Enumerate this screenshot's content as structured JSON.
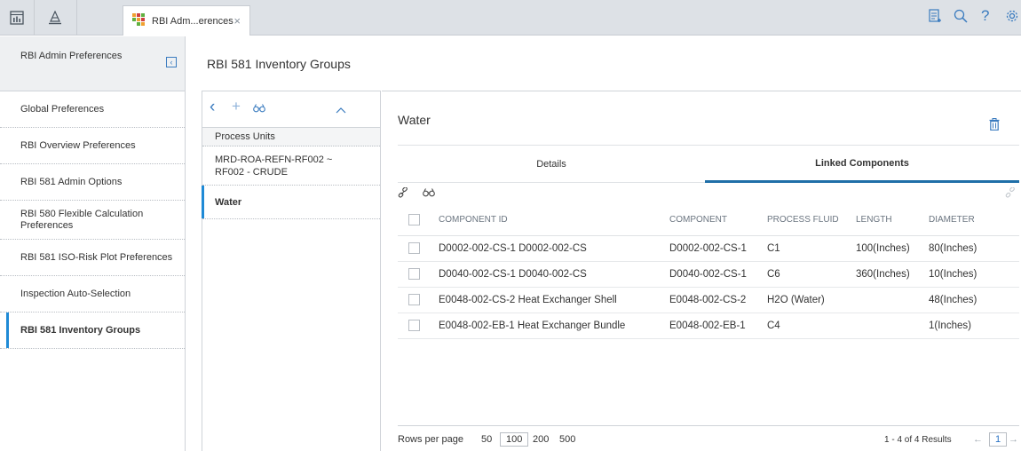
{
  "topbar": {
    "tab_label": "RBI Adm...erences",
    "tab_close": "×",
    "help_label": "?"
  },
  "sidebar": {
    "title": "RBI Admin Preferences",
    "collapse": "‹",
    "items": [
      {
        "label": "Global Preferences"
      },
      {
        "label": "RBI Overview Preferences"
      },
      {
        "label": "RBI 581 Admin Options"
      },
      {
        "label": "RBI 580 Flexible Calculation Preferences"
      },
      {
        "label": "RBI 581 ISO-Risk Plot Preferences"
      },
      {
        "label": "Inspection Auto-Selection"
      },
      {
        "label": "RBI 581 Inventory Groups"
      }
    ]
  },
  "main": {
    "page_title": "RBI 581 Inventory Groups"
  },
  "list": {
    "back": "‹",
    "add": "+",
    "collapse": "⌃",
    "header": "Process Units",
    "items": [
      {
        "label": "MRD-ROA-REFN-RF002 ~ RF002 - CRUDE"
      },
      {
        "label": "Water"
      }
    ]
  },
  "detail": {
    "title": "Water",
    "tabs": [
      {
        "label": "Details"
      },
      {
        "label": "Linked Components"
      }
    ],
    "columns": [
      "COMPONENT ID",
      "COMPONENT",
      "PROCESS FLUID",
      "LENGTH",
      "DIAMETER"
    ],
    "rows": [
      {
        "component_id": "D0002-002-CS-1 D0002-002-CS",
        "component": "D0002-002-CS-1",
        "fluid": "C1",
        "length": "100(Inches)",
        "diameter": "80(Inches)"
      },
      {
        "component_id": "D0040-002-CS-1 D0040-002-CS",
        "component": "D0040-002-CS-1",
        "fluid": "C6",
        "length": "360(Inches)",
        "diameter": "10(Inches)"
      },
      {
        "component_id": "E0048-002-CS-2 Heat Exchanger Shell",
        "component": "E0048-002-CS-2",
        "fluid": "H2O (Water)",
        "length": "",
        "diameter": "48(Inches)"
      },
      {
        "component_id": "E0048-002-EB-1 Heat Exchanger Bundle",
        "component": "E0048-002-EB-1",
        "fluid": "C4",
        "length": "",
        "diameter": "1(Inches)"
      }
    ],
    "footer": {
      "rows_per_page_label": "Rows per page",
      "options": [
        "50",
        "100",
        "200",
        "500"
      ],
      "selected_option": "100",
      "results": "1 - 4 of 4 Results",
      "page": "1",
      "prev": "←",
      "next": "→"
    }
  },
  "colors": {
    "accent": "#1f8ad6",
    "link": "#2a72c4",
    "icon": "#3a7bbf"
  }
}
